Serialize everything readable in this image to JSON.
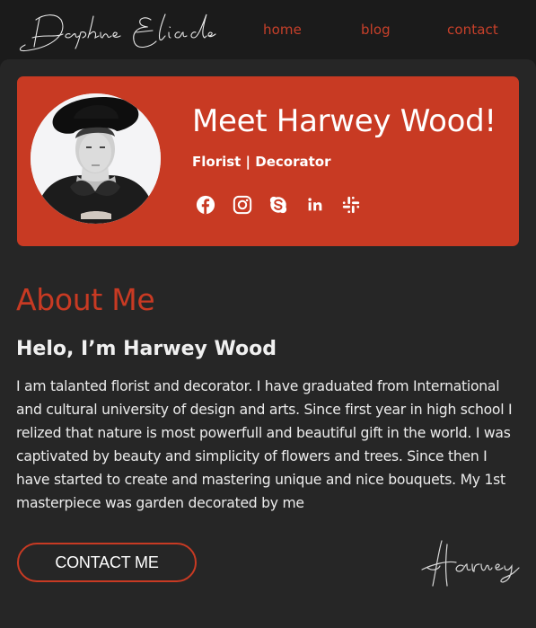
{
  "header": {
    "logo_text": "Daphne Eliade",
    "nav": [
      {
        "label": "home"
      },
      {
        "label": "blog"
      },
      {
        "label": "contact"
      }
    ]
  },
  "profile_card": {
    "title": "Meet Harwey Wood!",
    "subtitle": "Florist | Decorator",
    "avatar_alt": "Portrait of Harwey Wood wearing a black hat",
    "socials": [
      {
        "icon": "facebook-icon",
        "label": "Facebook"
      },
      {
        "icon": "instagram-icon",
        "label": "Instagram"
      },
      {
        "icon": "skype-icon",
        "label": "Skype"
      },
      {
        "icon": "linkedin-icon",
        "label": "LinkedIn"
      },
      {
        "icon": "slack-icon",
        "label": "Slack"
      }
    ]
  },
  "about": {
    "title": "About Me",
    "greeting": "Helo, I’m Harwey Wood",
    "text": "I am talanted florist and decorator. I have graduated from International and cultural university of design and arts. Since first year in high school I relized that nature is most powerfull and beautiful gift in the world. I was captivated by beauty and simplicity of flowers and trees. Since then I have started to create and mastering unique and nice bouquets. My 1st masterpiece was garden decorated by me",
    "contact_button": "CONTACT ME",
    "signature": "Harwey"
  },
  "colors": {
    "accent": "#c83a23",
    "header_bg": "#1b1b1b",
    "content_bg": "#262626",
    "text": "#f2f2f2"
  }
}
